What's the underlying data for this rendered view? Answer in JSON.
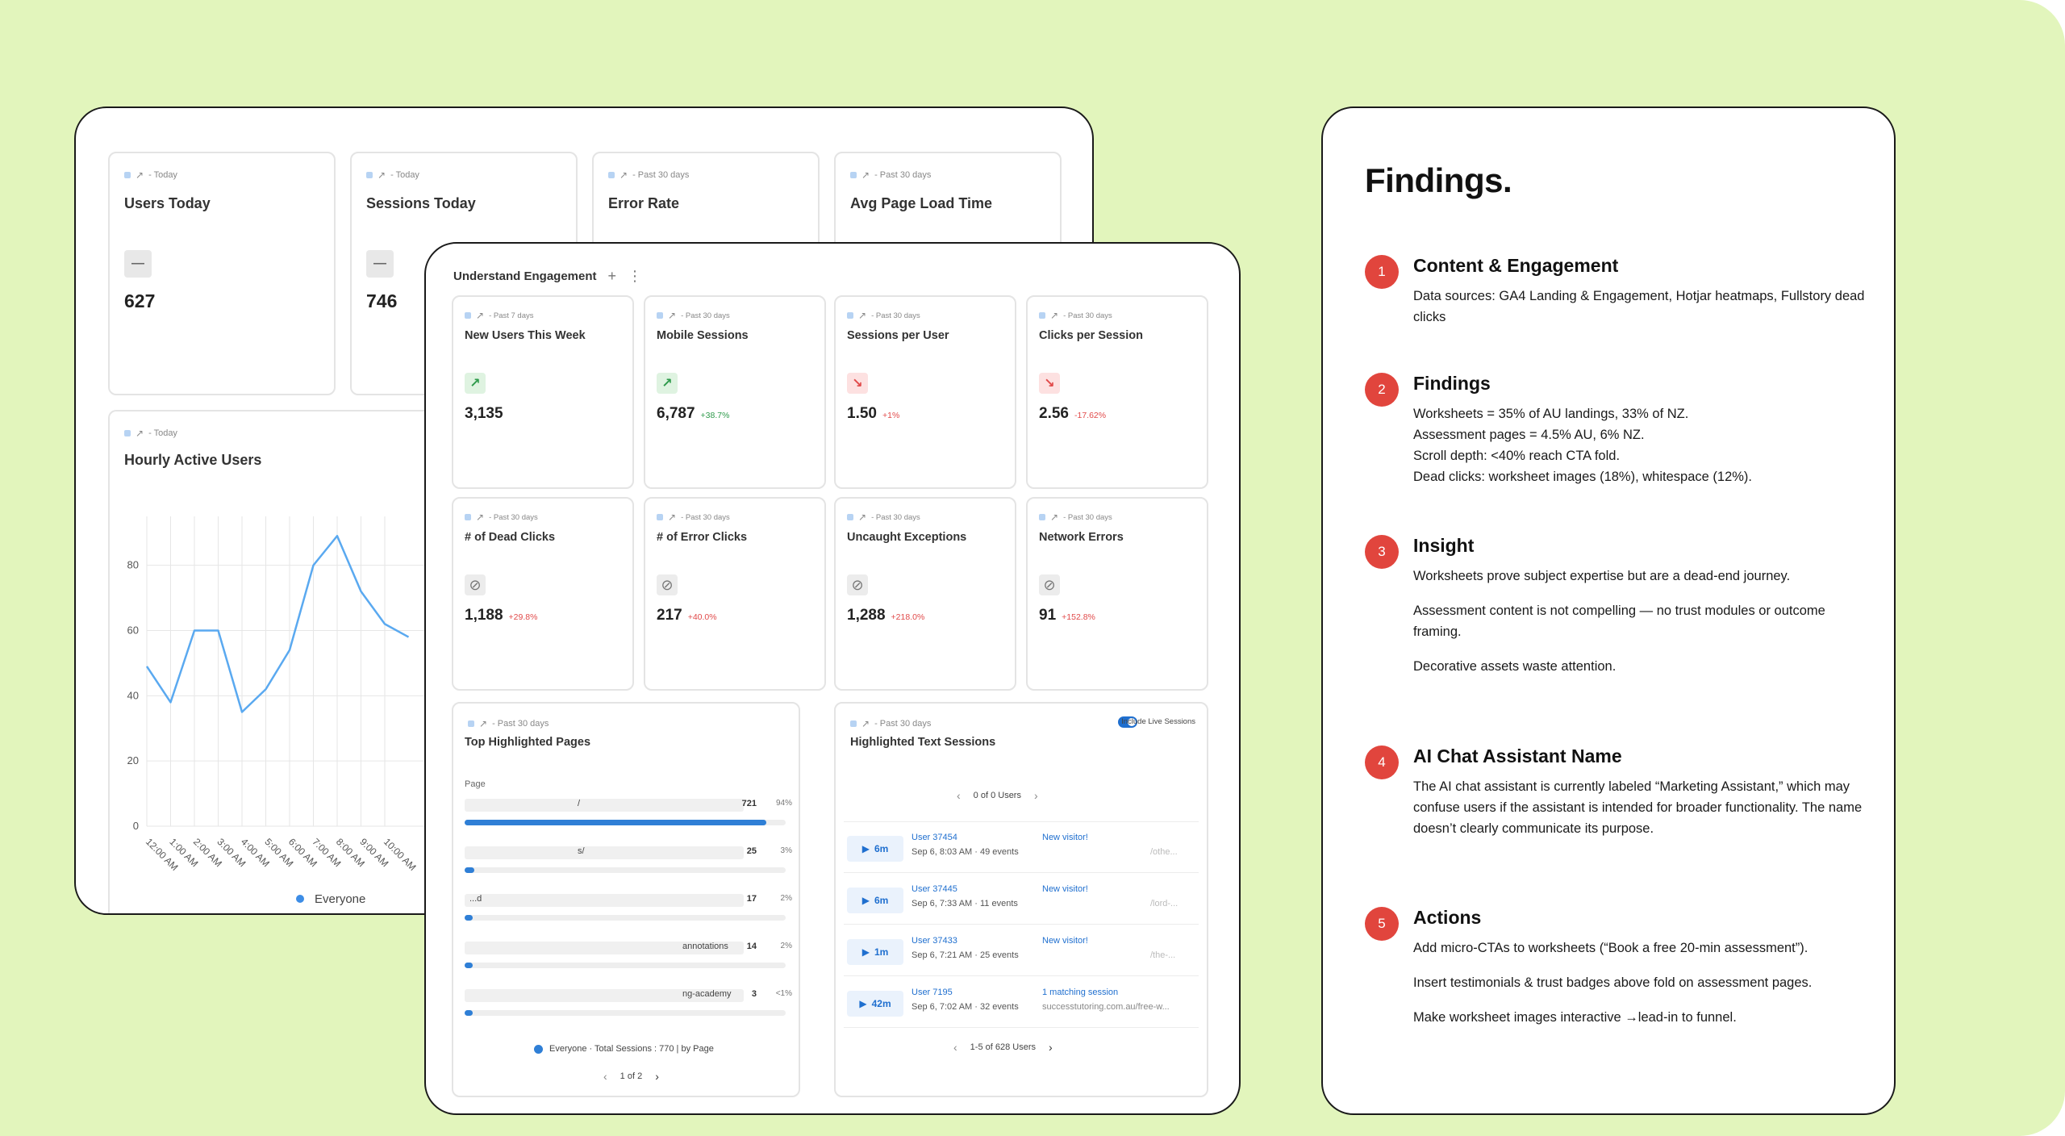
{
  "back": {
    "cards": [
      {
        "meta": "- Today",
        "title": "Users Today",
        "value": "627"
      },
      {
        "meta": "- Today",
        "title": "Sessions Today",
        "value": "746"
      },
      {
        "meta": "- Past 30 days",
        "title": "Error Rate"
      },
      {
        "meta": "- Past 30 days",
        "title": "Avg Page Load Time"
      }
    ],
    "hourly": {
      "meta": "- Today",
      "title": "Hourly Active Users",
      "legend": "Everyone"
    }
  },
  "chart_data": {
    "type": "line",
    "title": "Hourly Active Users",
    "x": [
      "12:00 AM",
      "1:00 AM",
      "2:00 AM",
      "3:00 AM",
      "4:00 AM",
      "5:00 AM",
      "6:00 AM",
      "7:00 AM",
      "8:00 AM",
      "9:00 AM",
      "10:00 AM"
    ],
    "series": [
      {
        "name": "Everyone",
        "values": [
          49,
          38,
          60,
          60,
          35,
          42,
          54,
          80,
          89,
          72,
          62,
          58
        ]
      }
    ],
    "y_ticks": [
      0,
      20,
      40,
      60,
      80
    ],
    "ylim": [
      0,
      95
    ],
    "grid": true,
    "legend": "bottom"
  },
  "front": {
    "header": "Understand Engagement",
    "header_plus": "+",
    "header_menu": "⋮",
    "metrics": [
      {
        "meta": "- Past 7 days",
        "title": "New Users This Week",
        "icon": "↗",
        "icon_kind": "green",
        "value": "3,135",
        "change": "",
        "dir": "pos"
      },
      {
        "meta": "- Past 30 days",
        "title": "Mobile Sessions",
        "icon": "↗",
        "icon_kind": "green",
        "value": "6,787",
        "change": "+38.7%",
        "dir": "pos"
      },
      {
        "meta": "- Past 30 days",
        "title": "Sessions per User",
        "icon": "↘",
        "icon_kind": "red",
        "value": "1.50",
        "change": "+1%",
        "dir": "neg"
      },
      {
        "meta": "- Past 30 days",
        "title": "Clicks per Session",
        "icon": "↘",
        "icon_kind": "red",
        "value": "2.56",
        "change": "-17.62%",
        "dir": "neg"
      },
      {
        "meta": "- Past 30 days",
        "title": "# of Dead Clicks",
        "icon": "⊘",
        "icon_kind": "block",
        "value": "1,188",
        "change": "+29.8%",
        "dir": "neg"
      },
      {
        "meta": "- Past 30 days",
        "title": "# of Error Clicks",
        "icon": "⊘",
        "icon_kind": "block",
        "value": "217",
        "change": "+40.0%",
        "dir": "neg"
      },
      {
        "meta": "- Past 30 days",
        "title": "Uncaught Exceptions",
        "icon": "⊘",
        "icon_kind": "block",
        "value": "1,288",
        "change": "+218.0%",
        "dir": "neg"
      },
      {
        "meta": "- Past 30 days",
        "title": "Network Errors",
        "icon": "⊘",
        "icon_kind": "block",
        "value": "91",
        "change": "+152.8%",
        "dir": "neg"
      }
    ],
    "top_pages": {
      "meta": "- Past 30 days",
      "title": "Top Highlighted Pages",
      "column": "Page",
      "rows": [
        {
          "label": "/",
          "count": "721",
          "pct": "94%",
          "fill": 0.94
        },
        {
          "label": "s/",
          "count": "25",
          "pct": "3%",
          "fill": 0.03
        },
        {
          "label": "...d",
          "count": "17",
          "pct": "2%",
          "fill": 0.02
        },
        {
          "label": "annotations",
          "count": "14",
          "pct": "2%",
          "fill": 0.02
        },
        {
          "label": "ng-academy",
          "count": "3",
          "pct": "<1%",
          "fill": 0.005
        }
      ],
      "legend": "Everyone · Total Sessions : 770 | by Page",
      "pager": "1 of 2",
      "prev": "‹",
      "next": "›"
    },
    "sessions": {
      "meta": "- Past 30 days",
      "title": "Highlighted Text Sessions",
      "toggle_label": "Include Live Sessions",
      "top_pager": "0 of 0 Users",
      "bottom_pager": "1-5 of 628 Users",
      "prev": "‹",
      "next": "›",
      "play": "▶",
      "rows": [
        {
          "dur": "6m",
          "user": "User 37454",
          "time": "Sep 6, 8:03 AM · 49 events",
          "tag": "New visitor!",
          "url": "",
          "tail": "/othe..."
        },
        {
          "dur": "6m",
          "user": "User 37445",
          "time": "Sep 6, 7:33 AM · 11 events",
          "tag": "New visitor!",
          "url": "",
          "tail": "/lord-..."
        },
        {
          "dur": "1m",
          "user": "User 37433",
          "time": "Sep 6, 7:21 AM · 25 events",
          "tag": "New visitor!",
          "url": "",
          "tail": "/the-..."
        },
        {
          "dur": "42m",
          "user": "User 7195",
          "time": "Sep 6, 7:02 AM · 32 events",
          "tag": "1 matching session",
          "url": "successtutoring.com.au/free-w...",
          "tail": ""
        }
      ]
    }
  },
  "findings": {
    "title": "Findings.",
    "items": [
      {
        "num": "1",
        "head": "Content & Engagement",
        "body": [
          "Data sources: GA4 Landing & Engagement, Hotjar heatmaps, Fullstory dead clicks"
        ]
      },
      {
        "num": "2",
        "head": "Findings",
        "body": [
          "Worksheets = 35% of AU landings, 33% of NZ.\nAssessment pages = 4.5% AU, 6% NZ.\nScroll depth: <40% reach CTA fold.\nDead clicks: worksheet images (18%), whitespace (12%)."
        ]
      },
      {
        "num": "3",
        "head": "Insight",
        "body": [
          "Worksheets prove subject expertise but are a dead-end journey.",
          "Assessment content is not compelling — no trust modules or outcome framing.",
          "Decorative assets waste attention."
        ]
      },
      {
        "num": "4",
        "head": "AI Chat Assistant Name",
        "body": [
          "The AI chat assistant is currently labeled “Marketing Assistant,” which may confuse users if the assistant is intended for broader functionality. The name doesn’t clearly communicate its purpose."
        ]
      },
      {
        "num": "5",
        "head": "Actions",
        "body": [
          "Add micro-CTAs to worksheets (“Book a free 20-min assessment”).",
          "Insert testimonials & trust badges above fold on assessment pages.",
          "Make worksheet images interactive →lead-in to funnel."
        ]
      }
    ]
  },
  "colors": {
    "background": "#e2f5bc",
    "accent_blue": "#2f7fd6",
    "number_badge": "#e1453d",
    "line": "#5aa9f0"
  }
}
